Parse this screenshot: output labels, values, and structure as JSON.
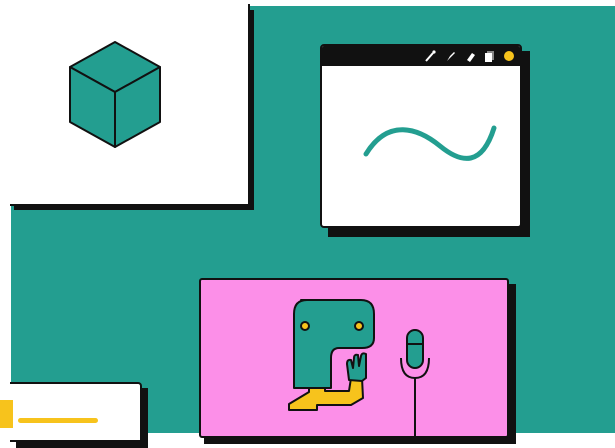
{
  "colors": {
    "background": "#239e90",
    "card": "#ffffff",
    "outline": "#111111",
    "cube": "#239e90",
    "stroke_teal": "#239e90",
    "stage": "#fc8fe8",
    "character": "#239e90",
    "torso": "#f7c31c",
    "accent_yellow": "#f7c31c",
    "eye": "#f7c31c"
  },
  "illustration": {
    "cube_card": {
      "icon": "cube-icon"
    },
    "drawing_window": {
      "toolbar_icons": [
        "brush-icon",
        "pen-nib-icon",
        "eraser-icon",
        "layers-icon",
        "color-dot-icon"
      ],
      "canvas_content": "wave-stroke"
    },
    "stage_card": {
      "figures": [
        "character-figure",
        "microphone-icon"
      ]
    },
    "note_card": {
      "content": "yellow-line"
    }
  }
}
